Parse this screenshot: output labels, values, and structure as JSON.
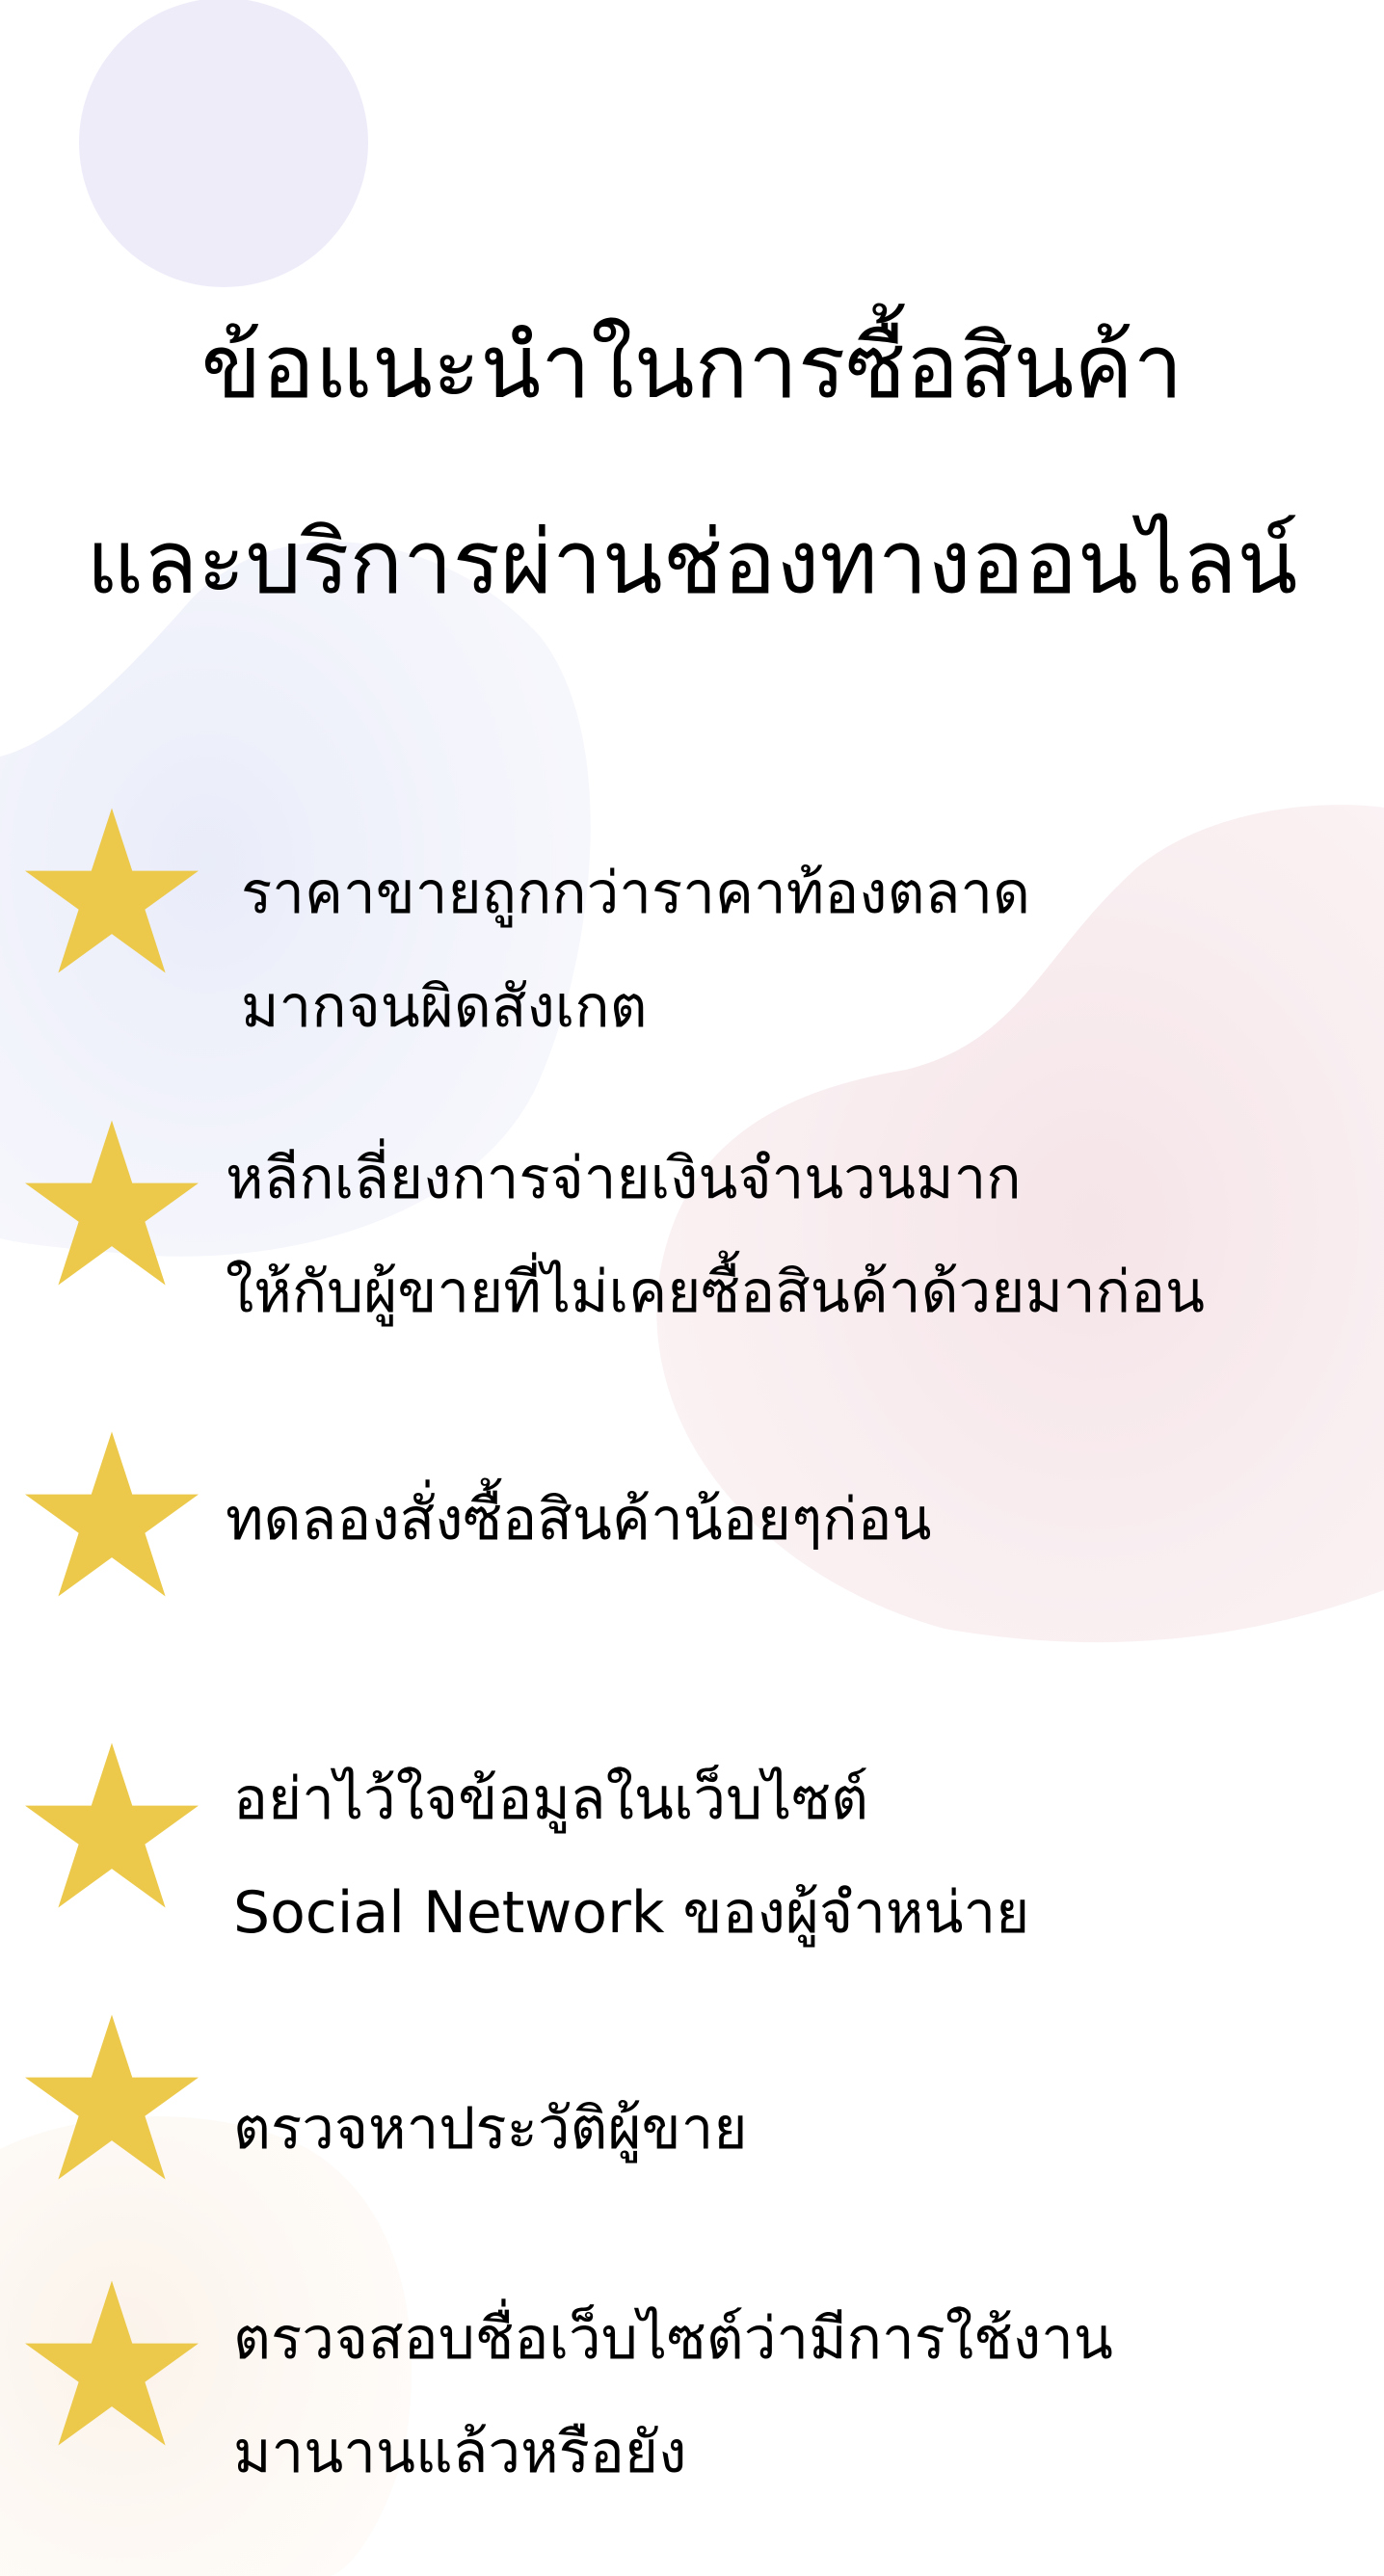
{
  "title": {
    "line1": "ข้อแนะนำในการซื้อสินค้า",
    "line2": "และบริการผ่านช่องทางออนไลน์"
  },
  "tips": [
    {
      "lines": [
        "ราคาขายถูกกว่าราคาท้องตลาด",
        "มากจนผิดสังเกต"
      ]
    },
    {
      "lines": [
        "หลีกเลี่ยงการจ่ายเงินจำนวนมาก",
        "ให้กับผู้ขายที่ไม่เคยซื้อสินค้าด้วยมาก่อน"
      ]
    },
    {
      "lines": [
        "ทดลองสั่งซื้อสินค้าน้อยๆก่อน"
      ]
    },
    {
      "lines": [
        "อย่าไว้ใจข้อมูลในเว็บไซต์",
        "Social Network ของผู้จำหน่าย"
      ]
    },
    {
      "lines": [
        "ตรวจหาประวัติผู้ขาย"
      ]
    },
    {
      "lines": [
        "ตรวจสอบชื่อเว็บไซต์ว่ามีการใช้งาน",
        "มานานแล้วหรือยัง"
      ]
    }
  ],
  "icons": {
    "tip_marker": "star-icon"
  },
  "colors": {
    "background": "#ffffff",
    "star": "#ecc94b",
    "text": "#000000",
    "blob_lavender": "#eeeaf8",
    "blob_blue": "#eceef9",
    "blob_pink": "#f6e7ea",
    "blob_cream": "#fbf4ec"
  }
}
